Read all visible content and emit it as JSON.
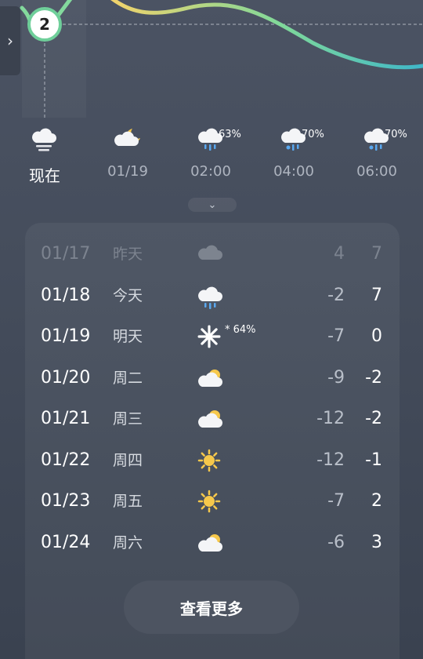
{
  "header": {
    "marker_number": "2",
    "side_tab_icon": "chevron-right-icon"
  },
  "hourly": [
    {
      "label": "现在",
      "icon": "cloud-fog-icon",
      "precip": ""
    },
    {
      "label": "01/19",
      "icon": "partly-cloudy-night-icon",
      "precip": ""
    },
    {
      "label": "02:00",
      "icon": "cloud-rain-icon",
      "precip": "63%"
    },
    {
      "label": "04:00",
      "icon": "cloud-sleet-icon",
      "precip": "70%"
    },
    {
      "label": "06:00",
      "icon": "cloud-sleet-icon",
      "precip": "70%"
    }
  ],
  "daily": [
    {
      "date": "01/17",
      "day": "昨天",
      "icon": "cloud-icon",
      "precip": "",
      "low": "4",
      "high": "7",
      "dim": true
    },
    {
      "date": "01/18",
      "day": "今天",
      "icon": "cloud-rain-icon",
      "precip": "",
      "low": "-2",
      "high": "7",
      "dim": false
    },
    {
      "date": "01/19",
      "day": "明天",
      "icon": "snowflake-icon",
      "precip": "64%",
      "low": "-7",
      "high": "0",
      "dim": false
    },
    {
      "date": "01/20",
      "day": "周二",
      "icon": "partly-cloudy-icon",
      "precip": "",
      "low": "-9",
      "high": "-2",
      "dim": false
    },
    {
      "date": "01/21",
      "day": "周三",
      "icon": "partly-cloudy-icon",
      "precip": "",
      "low": "-12",
      "high": "-2",
      "dim": false
    },
    {
      "date": "01/22",
      "day": "周四",
      "icon": "sun-icon",
      "precip": "",
      "low": "-12",
      "high": "-1",
      "dim": false
    },
    {
      "date": "01/23",
      "day": "周五",
      "icon": "sun-icon",
      "precip": "",
      "low": "-7",
      "high": "2",
      "dim": false
    },
    {
      "date": "01/24",
      "day": "周六",
      "icon": "partly-cloudy-icon",
      "precip": "",
      "low": "-6",
      "high": "3",
      "dim": false
    }
  ],
  "more_button": "查看更多",
  "colors": {
    "curve_start": "#f3d36b",
    "curve_mid": "#7fd89a",
    "curve_end": "#3fb7c9",
    "sun": "#f6c84b"
  }
}
